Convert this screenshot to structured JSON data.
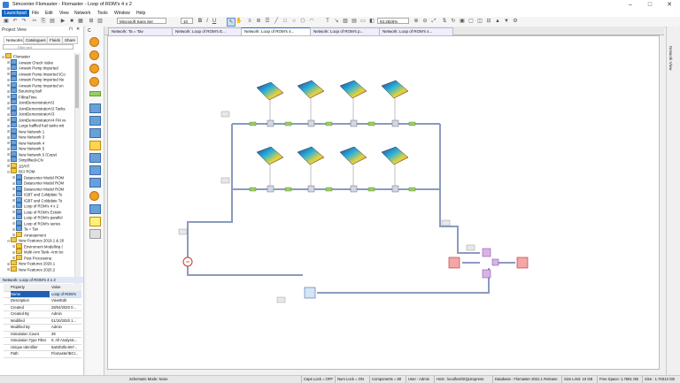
{
  "app": {
    "title": "Simcenter Flomaster - Flomaster - Loop of ROM's 4 x 2",
    "colors": {
      "accent": "#1565c0",
      "pipe": "#8a9bbf",
      "status_bg": "#e7e7e7"
    }
  },
  "menu": {
    "launchpad": "Launchpad",
    "file": "File",
    "edit": "Edit",
    "view": "View",
    "network": "Network",
    "tools": "Tools",
    "window": "Window",
    "help": "Help"
  },
  "toolbar": {
    "font": "Microsoft Sans Ser",
    "font_size": "10",
    "zoom": "63.2825%"
  },
  "project_view": {
    "title": "Project View",
    "tabs": [
      "Networks",
      "Catalogues",
      "Fluids",
      "Share"
    ],
    "filter_placeholder": "Filter text",
    "tree": [
      {
        "label": "Flomaster",
        "level": 0,
        "kind": "folder",
        "exp": "⊟"
      },
      {
        "label": "Anwain Check Valve",
        "level": 1,
        "kind": "net",
        "exp": "⊞"
      },
      {
        "label": "Anwain Pump Imported",
        "level": 1,
        "kind": "net",
        "exp": "⊞"
      },
      {
        "label": "Anwain Pump Imported (Co",
        "level": 1,
        "kind": "net",
        "exp": "⊞"
      },
      {
        "label": "Anwain Pump Imported Ne",
        "level": 1,
        "kind": "net",
        "exp": "⊞"
      },
      {
        "label": "Anwain Pump Imported en",
        "level": 1,
        "kind": "net",
        "exp": "⊞"
      },
      {
        "label": "Bouncing ball",
        "level": 1,
        "kind": "net",
        "exp": "⊞"
      },
      {
        "label": "FillingTime",
        "level": 1,
        "kind": "net",
        "exp": "⊞"
      },
      {
        "label": "JointDemonstratorV2",
        "level": 1,
        "kind": "net",
        "exp": "⊞"
      },
      {
        "label": "JointDemonstratorV2 Tanks",
        "level": 1,
        "kind": "net",
        "exp": "⊞"
      },
      {
        "label": "JointDemonstratorV3",
        "level": 1,
        "kind": "net",
        "exp": "⊞"
      },
      {
        "label": "JointDemonstratorV4 FM vs",
        "level": 1,
        "kind": "net",
        "exp": "⊞"
      },
      {
        "label": "Large baffled fuel tanks wit",
        "level": 1,
        "kind": "net",
        "exp": "⊞"
      },
      {
        "label": "New Network 1",
        "level": 1,
        "kind": "net",
        "exp": "⊞"
      },
      {
        "label": "New Network 3",
        "level": 1,
        "kind": "net",
        "exp": "⊞"
      },
      {
        "label": "New Network 4",
        "level": 1,
        "kind": "net",
        "exp": "⊞"
      },
      {
        "label": "New Network 5",
        "level": 1,
        "kind": "net",
        "exp": "⊞"
      },
      {
        "label": "New Network 5 (Copy)",
        "level": 1,
        "kind": "net",
        "exp": "⊞"
      },
      {
        "label": "SimplifiedACN",
        "level": 1,
        "kind": "net",
        "exp": "⊞"
      },
      {
        "label": "1D/HT",
        "level": 1,
        "kind": "folder",
        "exp": "⊞"
      },
      {
        "label": "BCI ROM",
        "level": 1,
        "kind": "folder",
        "exp": "⊟"
      },
      {
        "label": "Datacenter Model ROM",
        "level": 2,
        "kind": "net",
        "exp": "⊞"
      },
      {
        "label": "Datacenter Model ROM",
        "level": 2,
        "kind": "net",
        "exp": "⊞"
      },
      {
        "label": "Datacenter Model ROM",
        "level": 2,
        "kind": "net",
        "exp": "⊞"
      },
      {
        "label": "IGBT and Coldplate To",
        "level": 2,
        "kind": "net",
        "exp": "⊞"
      },
      {
        "label": "IGBT and Coldplate To",
        "level": 2,
        "kind": "net",
        "exp": "⊞"
      },
      {
        "label": "Loop of ROM's 4 x 2",
        "level": 2,
        "kind": "net",
        "exp": "⊞"
      },
      {
        "label": "Loop of ROM's Existin",
        "level": 2,
        "kind": "net",
        "exp": "⊞"
      },
      {
        "label": "Loop of ROM's parallel",
        "level": 2,
        "kind": "net",
        "exp": "⊞"
      },
      {
        "label": "Loop of ROM's series",
        "level": 2,
        "kind": "net",
        "exp": "⊞"
      },
      {
        "label": "Ta = Tav",
        "level": 2,
        "kind": "net",
        "exp": "⊞"
      },
      {
        "label": "Arrangement",
        "level": 2,
        "kind": "folder",
        "exp": "⊞"
      },
      {
        "label": "New Features 2019.1 & 20",
        "level": 1,
        "kind": "folder",
        "exp": "⊟"
      },
      {
        "label": "Enviroment Modelling (",
        "level": 2,
        "kind": "folder",
        "exp": "⊞"
      },
      {
        "label": "Multi Arm Tank- Arm bo",
        "level": 2,
        "kind": "folder",
        "exp": "⊞"
      },
      {
        "label": "Post Processing",
        "level": 2,
        "kind": "folder",
        "exp": "⊞"
      },
      {
        "label": "New Features 2020.1",
        "level": 1,
        "kind": "folder",
        "exp": "⊞"
      },
      {
        "label": "New Features 2020.2",
        "level": 1,
        "kind": "folder",
        "exp": "⊞"
      }
    ]
  },
  "properties": {
    "title": "Network: Loop of ROM's 4 x 2",
    "header": {
      "key": "Property",
      "value": "Value"
    },
    "rows": [
      {
        "key": "Name",
        "value": "Loop of ROM's"
      },
      {
        "key": "Description",
        "value": "View/Edit"
      },
      {
        "key": "Created",
        "value": "28/04/2020 0..."
      },
      {
        "key": "Created By",
        "value": "Admin"
      },
      {
        "key": "Modified",
        "value": "01/10/2020 1..."
      },
      {
        "key": "Modified By",
        "value": "Admin"
      },
      {
        "key": "Simulation Count",
        "value": "39"
      },
      {
        "key": "Simulation Type Filter",
        "value": "0: All Analysis..."
      },
      {
        "key": "Unique Identifier",
        "value": "6a04b3fa-557..."
      },
      {
        "key": "Path",
        "value": "Flomaster\\BCI..."
      }
    ]
  },
  "doc_tabs": [
    {
      "label": "Network: Ta = Tav"
    },
    {
      "label": "Network: Loop of ROM's E..."
    },
    {
      "label": "Network: Loop of ROM's 4..."
    },
    {
      "label": "Network: Loop of ROM's p..."
    },
    {
      "label": "Network: Loop of ROM's s..."
    }
  ],
  "right_strip": {
    "label": "Network View"
  },
  "status": {
    "mode": "Schematic Mode: None",
    "caps": "Caps Lock = OFF",
    "num": "Num Lock = ON",
    "components": "Components = 80",
    "user": "User : Admin",
    "host": "Host : localhost\\SQLExpress",
    "database": "Database : Flomaster 2021.1 Release",
    "size_limit": "Size Limit: 10 GB",
    "free_space": "Free Space: 1.7691 GB",
    "size": "Size : 1.70313 GB"
  }
}
